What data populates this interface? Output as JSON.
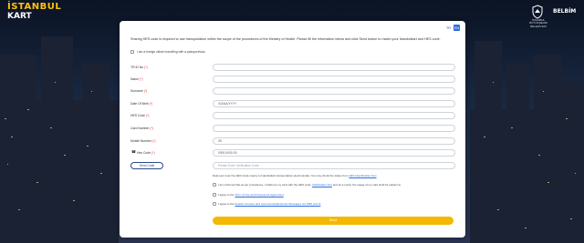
{
  "brand": {
    "line1": "İSTANBUL",
    "line2": "KART"
  },
  "header_right": {
    "ibb_caption": "İSTANBUL BÜYÜKŞEHİR BELEDİYESİ",
    "bilbim": "BELBİM"
  },
  "lang": {
    "tr": "TR",
    "en": "EN"
  },
  "intro": "Sharing HES code is required to use transportation within the scope of the procedures of the Ministry of Health. Please fill the information below and click Send button to match your İstanbulkart and HES code.",
  "consent": "I am a foreign citizen travelling with a passport/visa.",
  "fields": [
    {
      "label": "TR ID No",
      "req": "(*)",
      "value": "",
      "placeholder": ""
    },
    {
      "label": "Name",
      "req": "(*)",
      "value": "",
      "placeholder": ""
    },
    {
      "label": "Surname",
      "req": "(*)",
      "value": "",
      "placeholder": ""
    },
    {
      "label": "Date Of Birth",
      "req": "(*)",
      "value": "GG/AA/YYYY",
      "placeholder": ""
    },
    {
      "label": "HES Code",
      "req": "(*)",
      "value": "",
      "placeholder": ""
    },
    {
      "label": "Card Number",
      "req": "(*)",
      "value": "",
      "placeholder": ""
    },
    {
      "label": "Mobile Number",
      "req": "(*)",
      "value": "05",
      "placeholder": ""
    },
    {
      "label": "Hes Code",
      "req": "(*)",
      "value": "0000-0000-00",
      "placeholder": ""
    }
  ],
  "send_code": "Send Code",
  "verification_placeholder": "Please Enter Verification Code",
  "note": {
    "text": "Data sent over the HES Code inquiry to İstanbulkart transportation electronically. You may check the status from ",
    "link": "HES Identification Text"
  },
  "notice": {
    "text": "I am informed that as per procedures, I shall use my card with the HES code. ",
    "link": "Clarification Text",
    "rest": " and as a result, the usage of my card shall be subject to."
  },
  "terms": {
    "prefix": "I agree to the ",
    "link": "Term of Use and Framework Agreement",
    "suffix": "."
  },
  "marketing": {
    "prefix": "I agree to the ",
    "link": "Explicit Consent and Commercial Electronic Messages via SMS permit",
    "suffix": "."
  },
  "submit": "Send",
  "colors": {
    "accent": "#f5b800",
    "link": "#2d6cdf",
    "brand_yellow": "#ffc20e"
  }
}
